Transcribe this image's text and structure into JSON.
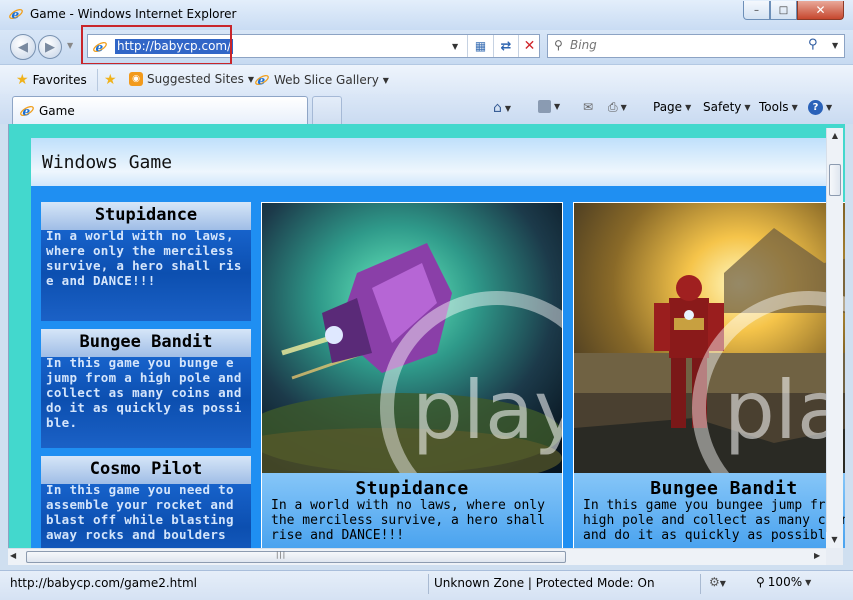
{
  "window": {
    "title": "Game - Windows Internet Explorer",
    "minimize_glyph": "–",
    "maximize_glyph": "□",
    "close_glyph": "✕"
  },
  "address_bar": {
    "url": "http://babycp.com/",
    "icon": "ie-page-icon"
  },
  "search": {
    "placeholder": "Bing"
  },
  "favorites_bar": {
    "favorites_label": "Favorites",
    "suggested_sites_label": "Suggested Sites",
    "web_slice_label": "Web Slice Gallery"
  },
  "tabs": [
    {
      "label": "Game"
    }
  ],
  "command_bar": {
    "page_label": "Page",
    "safety_label": "Safety",
    "tools_label": "Tools"
  },
  "page": {
    "title": "Windows Game",
    "sidebar": [
      {
        "title": "Stupidance",
        "desc": "In a world with no laws, where only the merciless survive, a hero shall rise and DANCE!!!"
      },
      {
        "title": "Bungee Bandit",
        "desc": "In this game you bunge e jump from a high pole and collect as many coins and do it as quickly as possible."
      },
      {
        "title": "Cosmo Pilot",
        "desc": "In this game you need to assemble your rocket and blast off while blasting away rocks and boulders"
      }
    ],
    "cards": [
      {
        "title": "Stupidance",
        "desc_lines": [
          "In a world with no laws, where only",
          "the merciless survive, a hero shall",
          "rise and DANCE!!!"
        ],
        "overlay": "play"
      },
      {
        "title": "Bungee Bandit",
        "desc_lines": [
          "In this game you bungee jump from a",
          "high pole and collect as many coins",
          "and do it as quickly as possible."
        ],
        "overlay": "play"
      }
    ]
  },
  "status_bar": {
    "url": "http://babycp.com/game2.html",
    "zone": "Unknown Zone | Protected Mode: On",
    "zoom": "100%"
  },
  "colors": {
    "viewport_bg": "#43d8cd",
    "page_bg": "#1f8ff2",
    "highlight_box": "#c8252b"
  }
}
